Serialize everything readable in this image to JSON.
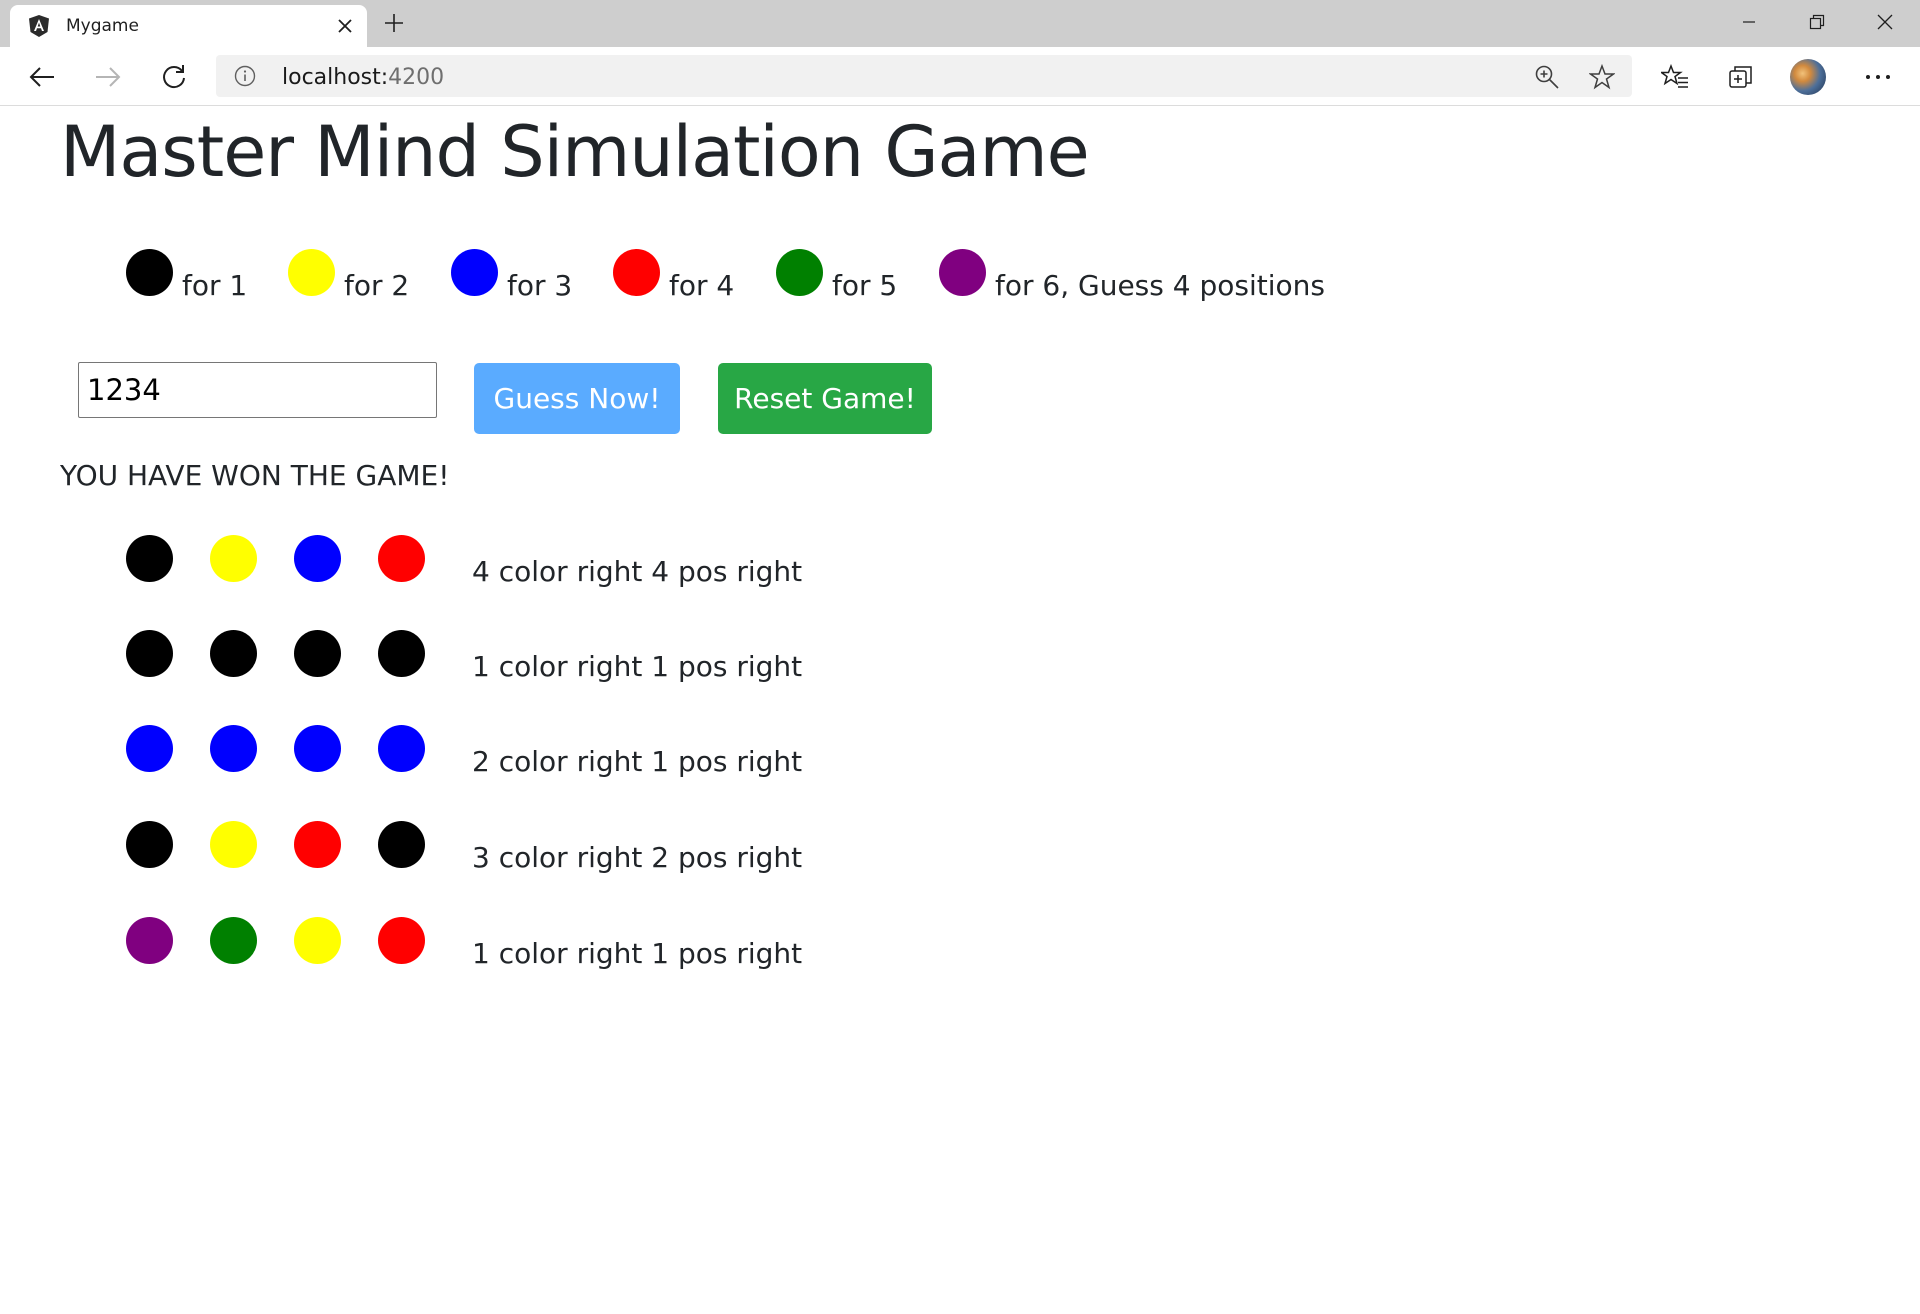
{
  "browser": {
    "tab_title": "Mygame",
    "url_host": "localhost:",
    "url_port": "4200"
  },
  "page": {
    "title": "Master Mind Simulation Game",
    "legend": [
      {
        "color": "#000000",
        "label": "for 1"
      },
      {
        "color": "#ffff00",
        "label": "for 2"
      },
      {
        "color": "#0000ff",
        "label": "for 3"
      },
      {
        "color": "#ff0000",
        "label": "for 4"
      },
      {
        "color": "#008000",
        "label": "for 5"
      },
      {
        "color": "#800080",
        "label": "for 6, Guess 4 positions"
      }
    ],
    "guess_input_value": "1234",
    "guess_button_label": "Guess Now!",
    "reset_button_label": "Reset Game!",
    "status_text": "YOU HAVE WON THE GAME!",
    "guesses": [
      {
        "pegs": [
          "#000000",
          "#ffff00",
          "#0000ff",
          "#ff0000"
        ],
        "feedback": "4 color right 4 pos right"
      },
      {
        "pegs": [
          "#000000",
          "#000000",
          "#000000",
          "#000000"
        ],
        "feedback": "1 color right 1 pos right"
      },
      {
        "pegs": [
          "#0000ff",
          "#0000ff",
          "#0000ff",
          "#0000ff"
        ],
        "feedback": "2 color right 1 pos right"
      },
      {
        "pegs": [
          "#000000",
          "#ffff00",
          "#ff0000",
          "#000000"
        ],
        "feedback": "3 color right 2 pos right"
      },
      {
        "pegs": [
          "#800080",
          "#008000",
          "#ffff00",
          "#ff0000"
        ],
        "feedback": "1 color right 1 pos right"
      }
    ]
  }
}
